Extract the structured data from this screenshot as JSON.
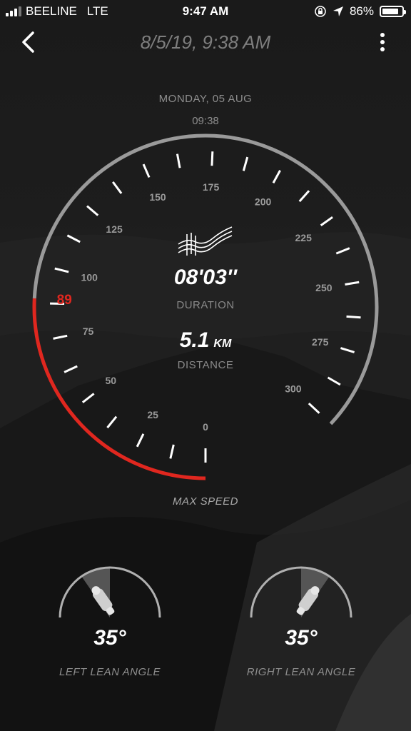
{
  "status_bar": {
    "carrier": "BEELINE",
    "network": "LTE",
    "time": "9:47 AM",
    "battery": "86%",
    "battery_level": 0.86
  },
  "header": {
    "title": "8/5/19, 9:38 AM"
  },
  "ride": {
    "date": "MONDAY, 05 AUG",
    "time": "09:38",
    "duration": "08'03''",
    "duration_label": "DURATION",
    "distance": "5.1",
    "distance_unit": "KM",
    "distance_label": "DISTANCE"
  },
  "speedometer": {
    "min": 0,
    "max": 300,
    "max_speed": 89,
    "max_speed_text": "89",
    "label": "MAX SPEED",
    "tick_labels": [
      "0",
      "25",
      "50",
      "75",
      "100",
      "125",
      "150",
      "175",
      "200",
      "225",
      "250",
      "275",
      "300"
    ],
    "accent": "#e0271f",
    "track_color": "#9a9a9a"
  },
  "lean": {
    "left": {
      "value": "35°",
      "label": "LEFT LEAN ANGLE"
    },
    "right": {
      "value": "35°",
      "label": "RIGHT LEAN ANGLE"
    }
  }
}
